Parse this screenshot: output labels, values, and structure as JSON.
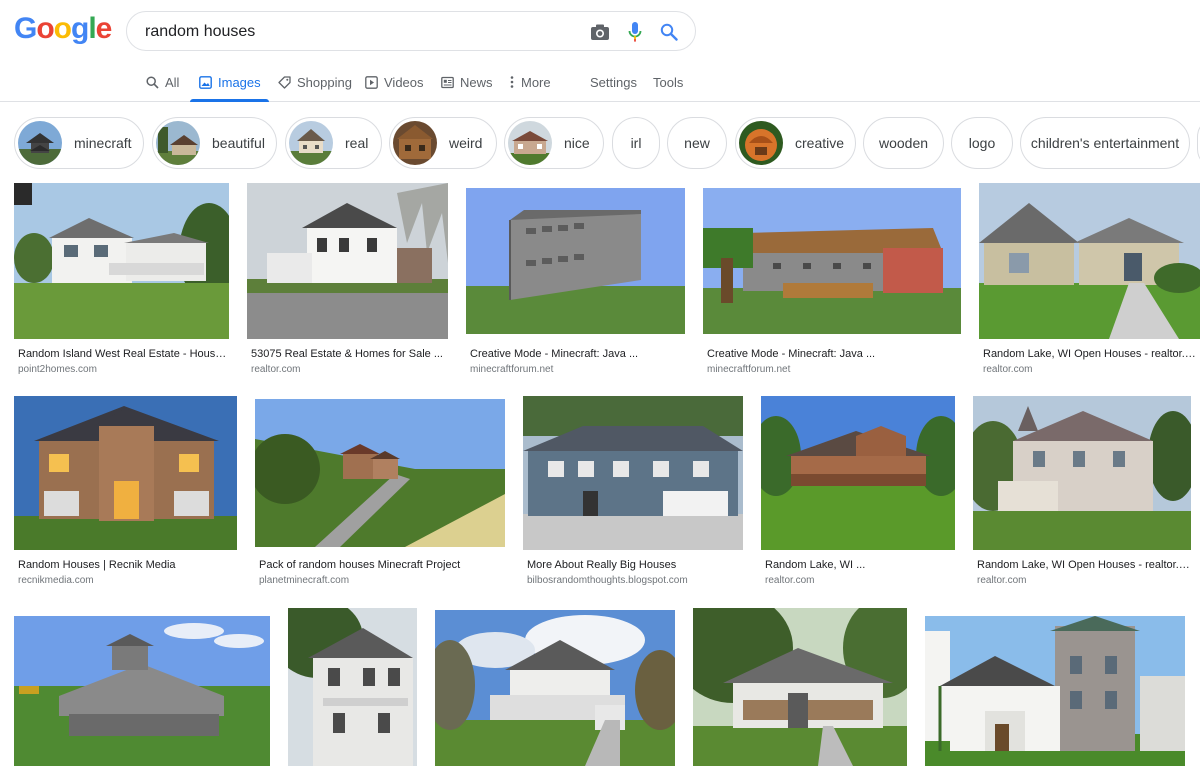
{
  "search": {
    "query": "random houses",
    "logo_letters": [
      {
        "ch": "G",
        "color": "#4285f4"
      },
      {
        "ch": "o",
        "color": "#ea4335"
      },
      {
        "ch": "o",
        "color": "#fbbc05"
      },
      {
        "ch": "g",
        "color": "#4285f4"
      },
      {
        "ch": "l",
        "color": "#34a853"
      },
      {
        "ch": "e",
        "color": "#ea4335"
      }
    ]
  },
  "tabs": {
    "all": "All",
    "images": "Images",
    "shopping": "Shopping",
    "videos": "Videos",
    "news": "News",
    "more": "More",
    "settings": "Settings",
    "tools": "Tools"
  },
  "chips": [
    "minecraft",
    "beautiful",
    "real",
    "weird",
    "nice",
    "irl",
    "new",
    "creative",
    "wooden",
    "logo",
    "children's entertainment"
  ],
  "results": [
    {
      "title": "Random Island West Real Estate - Houses ...",
      "source": "point2homes.com"
    },
    {
      "title": "53075 Real Estate & Homes for Sale ...",
      "source": "realtor.com"
    },
    {
      "title": "Creative Mode - Minecraft: Java ...",
      "source": "minecraftforum.net"
    },
    {
      "title": "Creative Mode - Minecraft: Java ...",
      "source": "minecraftforum.net"
    },
    {
      "title": "Random Lake, WI Open Houses - realtor.com",
      "source": "realtor.com"
    },
    {
      "title": "Random Houses | Recnik Media",
      "source": "recnikmedia.com"
    },
    {
      "title": "Pack of random houses Minecraft Project",
      "source": "planetminecraft.com"
    },
    {
      "title": "More About Really Big Houses",
      "source": "bilbosrandomthoughts.blogspot.com"
    },
    {
      "title": "Random Lake, WI ...",
      "source": "realtor.com"
    },
    {
      "title": "Random Lake, WI Open Houses - realtor.com",
      "source": "realtor.com"
    }
  ],
  "colors": {
    "accent": "#1a73e8",
    "text": "#202124",
    "muted": "#70757a",
    "border": "#dadce0"
  }
}
